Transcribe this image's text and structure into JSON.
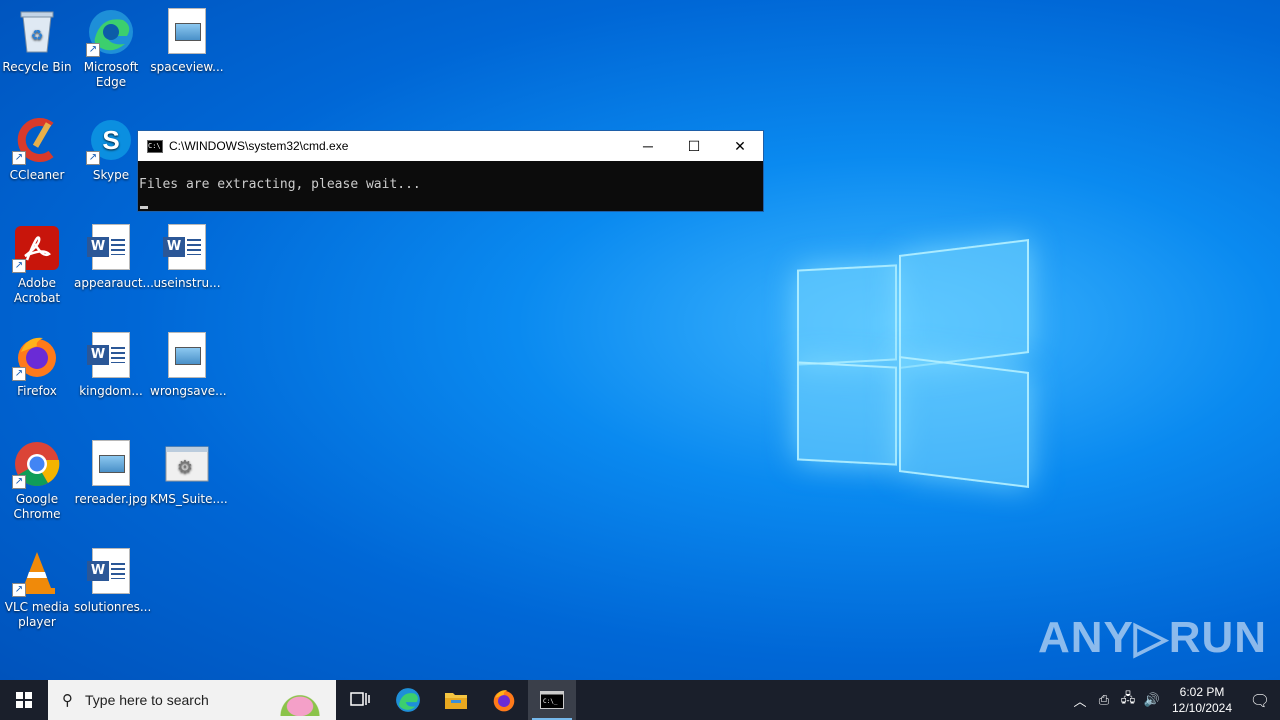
{
  "desktop": {
    "icons": [
      {
        "label": "Recycle Bin",
        "icon": "recycle-bin-icon"
      },
      {
        "label": "Microsoft Edge",
        "icon": "edge-icon"
      },
      {
        "label": "spaceview...",
        "icon": "image-file-icon"
      },
      {
        "label": "CCleaner",
        "icon": "ccleaner-icon"
      },
      {
        "label": "Skype",
        "icon": "skype-icon"
      },
      {
        "label": "Adobe Acrobat",
        "icon": "acrobat-icon"
      },
      {
        "label": "appearauct...",
        "icon": "word-doc-icon"
      },
      {
        "label": "useinstru...",
        "icon": "word-doc-icon"
      },
      {
        "label": "Firefox",
        "icon": "firefox-icon"
      },
      {
        "label": "kingdom...",
        "icon": "word-doc-icon"
      },
      {
        "label": "wrongsave...",
        "icon": "image-file-icon"
      },
      {
        "label": "Google Chrome",
        "icon": "chrome-icon"
      },
      {
        "label": "rereader.jpg",
        "icon": "image-file-icon"
      },
      {
        "label": "KMS_Suite....",
        "icon": "exe-file-icon"
      },
      {
        "label": "VLC media player",
        "icon": "vlc-icon"
      },
      {
        "label": "solutionres...",
        "icon": "word-doc-icon"
      }
    ]
  },
  "cmd_window": {
    "title": "C:\\WINDOWS\\system32\\cmd.exe",
    "output": "Files are extracting, please wait...",
    "minimize": "─",
    "maximize": "☐",
    "close": "✕"
  },
  "watermark": "ANY▷RUN",
  "taskbar": {
    "search_placeholder": "Type here to search",
    "time": "6:02 PM",
    "date": "12/10/2024"
  },
  "colors": {
    "taskbar": "#1a1f2b",
    "desktop_accent": "#0a8af0"
  }
}
